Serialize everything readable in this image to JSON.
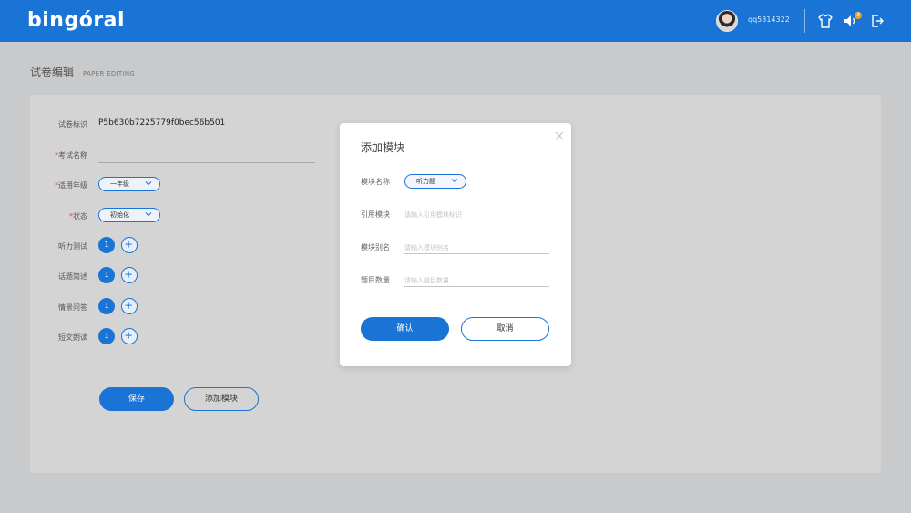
{
  "header": {
    "logo": "bingóral",
    "username": "qq5314322",
    "notification_count": "3",
    "brand_color": "#1a74d6",
    "icons": [
      "avatar",
      "shirt-icon",
      "speaker-icon",
      "logout-icon"
    ]
  },
  "page": {
    "title": "试卷编辑",
    "subtitle": "PAPER EDITING"
  },
  "form": {
    "id_label": "试卷标识",
    "id_value": "P5b630b7225779f0bec56b501",
    "name_label": "考试名称",
    "grade_label": "适用年级",
    "grade_value": "一年级",
    "status_label": "状态",
    "status_value": "初始化",
    "required_mark": "*",
    "modules": [
      {
        "label": "听力测试",
        "count": "1"
      },
      {
        "label": "话题简述",
        "count": "1"
      },
      {
        "label": "情景问答",
        "count": "1"
      },
      {
        "label": "短文朗读",
        "count": "1"
      }
    ],
    "save_label": "保存",
    "add_module_label": "添加模块"
  },
  "modal": {
    "title": "添加模块",
    "module_name_label": "模块名称",
    "module_name_value": "听力题",
    "ref_module_label": "引用模块",
    "ref_module_placeholder": "请输入引用模块标识",
    "alias_label": "模块别名",
    "alias_placeholder": "请输入模块别名",
    "question_count_label": "题目数量",
    "question_count_placeholder": "请输入题目数量",
    "confirm_label": "确认",
    "cancel_label": "取消"
  }
}
